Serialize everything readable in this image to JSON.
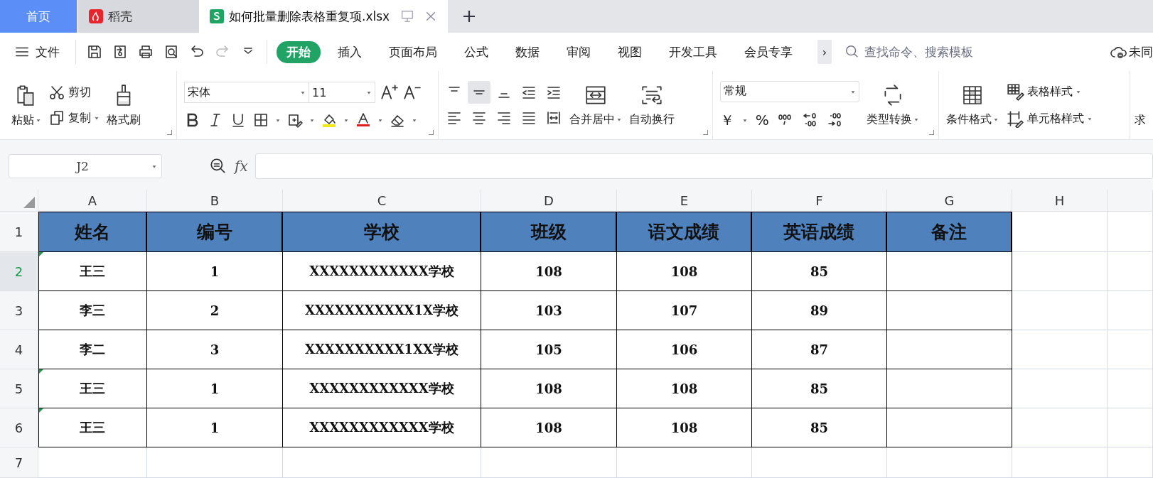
{
  "tabs": [
    {
      "label": "首页",
      "kind": "home",
      "selected": false
    },
    {
      "label": "稻壳",
      "kind": "app",
      "selected": false
    },
    {
      "label": "如何批量删除表格重复项.xlsx",
      "kind": "doc",
      "selected": true
    }
  ],
  "file_menu": "文件",
  "ribbon_tabs": [
    {
      "label": "开始",
      "selected": true
    },
    {
      "label": "插入",
      "selected": false
    },
    {
      "label": "页面布局",
      "selected": false
    },
    {
      "label": "公式",
      "selected": false
    },
    {
      "label": "数据",
      "selected": false
    },
    {
      "label": "审阅",
      "selected": false
    },
    {
      "label": "视图",
      "selected": false
    },
    {
      "label": "开发工具",
      "selected": false
    },
    {
      "label": "会员专享",
      "selected": false
    }
  ],
  "more_tabs": "›",
  "search": {
    "placeholder": "查找命令、搜索模板"
  },
  "sync_status": "未同",
  "ribbon": {
    "paste": "粘贴",
    "cut": "剪切",
    "copy": "复制",
    "format_painter": "格式刷",
    "font_name": "宋体",
    "font_size": "11",
    "merge": "合并居中",
    "wrap": "自动换行",
    "number_format": "常规",
    "currency": "￥",
    "percent": "%",
    "convert": "类型转换",
    "conditional_format": "条件格式",
    "table_style": "表格样式",
    "cell_style": "单元格样式",
    "cut_off": "求"
  },
  "formula_bar": {
    "name_box": "J2",
    "fx": "fx"
  },
  "sheet": {
    "columns": [
      {
        "label": "A",
        "selected": false
      },
      {
        "label": "B",
        "selected": false
      },
      {
        "label": "C",
        "selected": false
      },
      {
        "label": "D",
        "selected": false
      },
      {
        "label": "E",
        "selected": false
      },
      {
        "label": "F",
        "selected": false
      },
      {
        "label": "G",
        "selected": false
      },
      {
        "label": "H",
        "selected": false
      }
    ],
    "rows": [
      {
        "label": "1",
        "kind": "header",
        "selected": false,
        "flagged": false,
        "cells": [
          "姓名",
          "编号",
          "学校",
          "班级",
          "语文成绩",
          "英语成绩",
          "备注"
        ]
      },
      {
        "label": "2",
        "kind": "data",
        "selected": true,
        "flagged": true,
        "cells": [
          "王三",
          "1",
          "XXXXXXXXXXXX学校",
          "108",
          "108",
          "85"
        ]
      },
      {
        "label": "3",
        "kind": "data",
        "selected": false,
        "flagged": false,
        "cells": [
          "李三",
          "2",
          "XXXXXXXXXXX1X学校",
          "103",
          "107",
          "89"
        ]
      },
      {
        "label": "4",
        "kind": "data",
        "selected": false,
        "flagged": false,
        "cells": [
          "李二",
          "3",
          "XXXXXXXXXX1XX学校",
          "105",
          "106",
          "87"
        ]
      },
      {
        "label": "5",
        "kind": "data",
        "selected": false,
        "flagged": true,
        "cells": [
          "王三",
          "1",
          "XXXXXXXXXXXX学校",
          "108",
          "108",
          "85"
        ]
      },
      {
        "label": "6",
        "kind": "data",
        "selected": false,
        "flagged": true,
        "cells": [
          "王三",
          "1",
          "XXXXXXXXXXXX学校",
          "108",
          "108",
          "85"
        ]
      },
      {
        "label": "7",
        "kind": "blank",
        "selected": false,
        "flagged": false
      }
    ]
  }
}
